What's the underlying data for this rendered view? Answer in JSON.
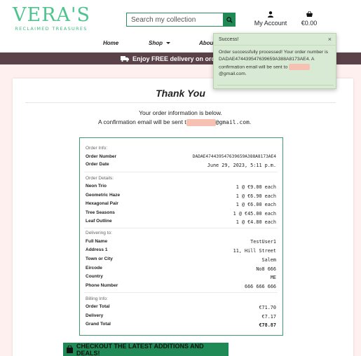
{
  "logo": {
    "main": "VERA'S",
    "sub": "RECLAIMED TREASURES"
  },
  "search": {
    "placeholder": "Search my collection"
  },
  "account": {
    "label": "My Account"
  },
  "bag": {
    "total": "€0.00"
  },
  "nav": {
    "home": "Home",
    "shop": "Shop",
    "about": "About"
  },
  "banner": {
    "text": "Enjoy FREE delivery on orders"
  },
  "toast": {
    "title": "Success!",
    "close": "×",
    "message": "Order successfully processed! Your order number is DADAE474439547639659A388A8173AE4. A confirmation email will be sent to",
    "email_suffix": "@gmail.com."
  },
  "page": {
    "title": "Thank You",
    "info_line1": "Your order information is below.",
    "info_line2_prefix": "A confirmation email will be sent t",
    "info_line2_suffix": "@gmail.com",
    "info_line2_end": "."
  },
  "order": {
    "order_info_heading": "Order Info:",
    "order_number_label": "Order Number",
    "order_number": "DADAE474439547639659A388A8173AE4",
    "order_date_label": "Order Date",
    "order_date": "June 29, 2023, 5:11 p.m.",
    "details_heading": "Order Details:",
    "items": [
      {
        "name": "Neon Trio",
        "qty": "1 @ €9.00 each"
      },
      {
        "name": "Geometric Haze",
        "qty": "1 @ €6.90 each"
      },
      {
        "name": "Hexagonal Pair",
        "qty": "1 @ €6.00 each"
      },
      {
        "name": "Tree Seasons",
        "qty": "1 @ €45.00 each"
      },
      {
        "name": "Leaf Outline",
        "qty": "1 @ €4.80 each"
      }
    ],
    "delivering_heading": "Delivering to:",
    "delivery": [
      {
        "label": "Full Name",
        "value": "TestUser1"
      },
      {
        "label": "Address 1",
        "value": "11, Hill Street"
      },
      {
        "label": "Town or City",
        "value": "Salem"
      },
      {
        "label": "Eircode",
        "value": "No8 666"
      },
      {
        "label": "Country",
        "value": "ME"
      },
      {
        "label": "Phone Number",
        "value": "666 666 666"
      }
    ],
    "billing_heading": "Billing Info:",
    "billing": [
      {
        "label": "Order Total",
        "value": "€71.70"
      },
      {
        "label": "Delivery",
        "value": "€7.17"
      },
      {
        "label": "Grand Total",
        "value": "€78.87"
      }
    ]
  },
  "cta": {
    "label": "CHECKOUT THE LATEST ADDITIONS AND DEALS!"
  },
  "colors": {
    "brand": "#4fc38e",
    "cta": "#1f8a55",
    "banner": "#5b4148",
    "toast_bg": "#d8ead3",
    "redaction": "#f6c1b3"
  }
}
